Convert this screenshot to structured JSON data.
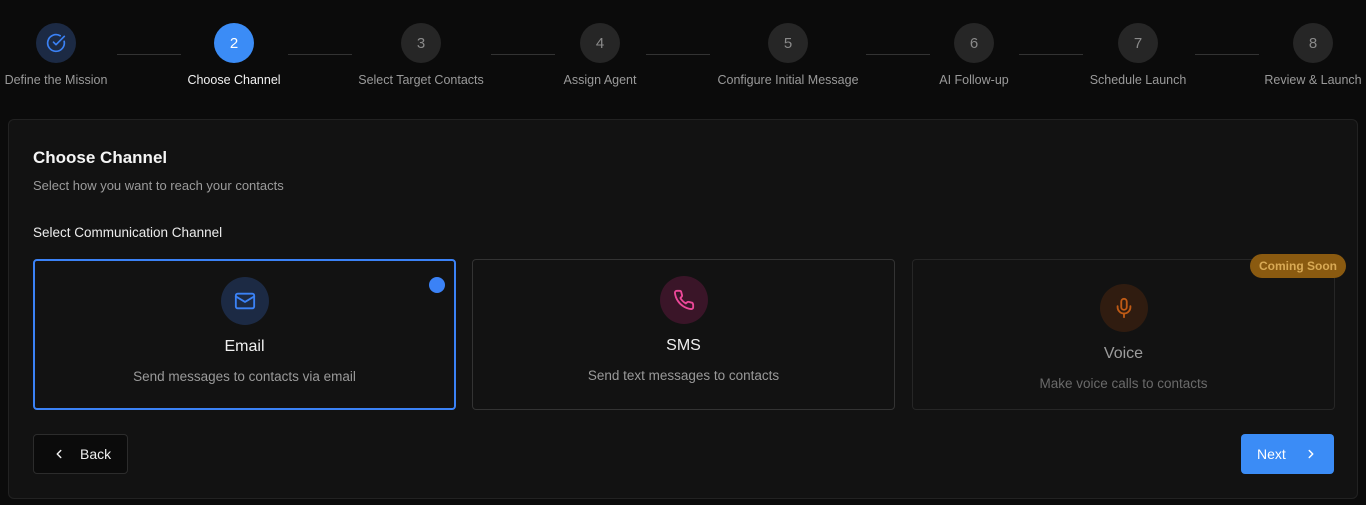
{
  "stepper": {
    "steps": [
      {
        "number": "",
        "label": "Define the Mission",
        "state": "done"
      },
      {
        "number": "2",
        "label": "Choose Channel",
        "state": "active"
      },
      {
        "number": "3",
        "label": "Select Target Contacts",
        "state": "pending"
      },
      {
        "number": "4",
        "label": "Assign Agent",
        "state": "pending"
      },
      {
        "number": "5",
        "label": "Configure Initial Message",
        "state": "pending"
      },
      {
        "number": "6",
        "label": "AI Follow-up",
        "state": "pending"
      },
      {
        "number": "7",
        "label": "Schedule Launch",
        "state": "pending"
      },
      {
        "number": "8",
        "label": "Review & Launch",
        "state": "pending"
      }
    ]
  },
  "card": {
    "title": "Choose Channel",
    "subtitle": "Select how you want to reach your contacts",
    "section_label": "Select Communication Channel"
  },
  "channels": [
    {
      "title": "Email",
      "description": "Send messages to contacts via email",
      "icon": "mail-icon",
      "selected": true,
      "accent": "#3b82f6"
    },
    {
      "title": "SMS",
      "description": "Send text messages to contacts",
      "icon": "phone-icon",
      "selected": false,
      "accent": "#ec4899"
    },
    {
      "title": "Voice",
      "description": "Make voice calls to contacts",
      "icon": "mic-icon",
      "selected": false,
      "disabled": true,
      "badge": "Coming Soon",
      "accent": "#f97316"
    }
  ],
  "nav": {
    "back_label": "Back",
    "next_label": "Next"
  },
  "colors": {
    "primary": "#3b8cf6",
    "background": "#0b0b0b",
    "card": "#121212",
    "badge": "#8a5a10"
  }
}
